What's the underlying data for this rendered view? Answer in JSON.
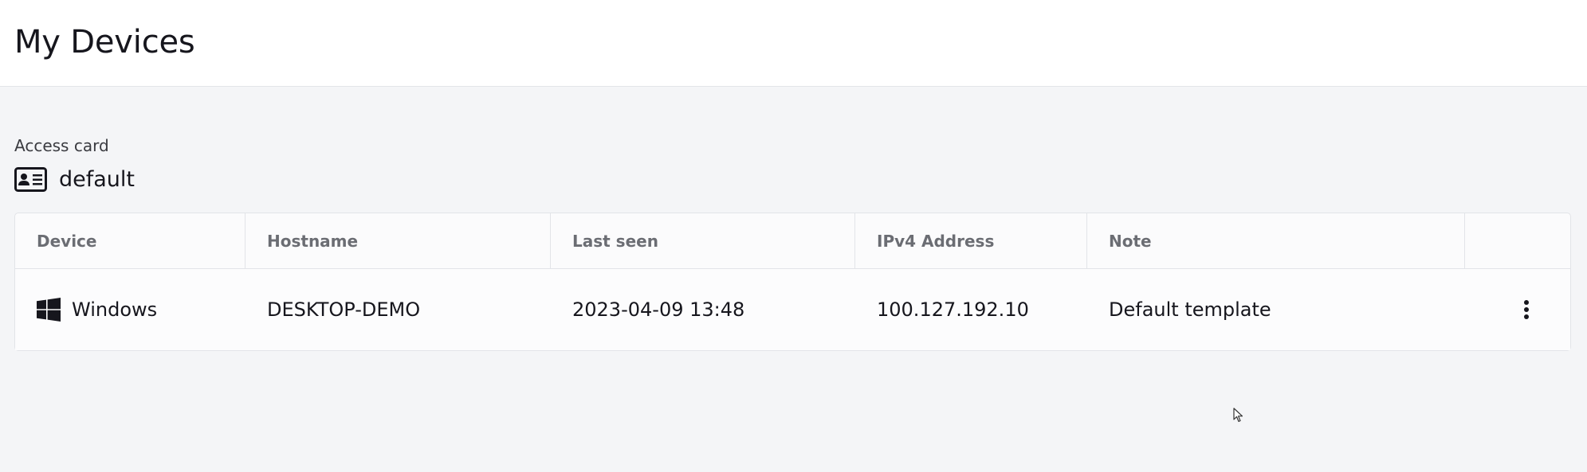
{
  "header": {
    "title": "My Devices"
  },
  "access_card": {
    "label": "Access card",
    "name": "default",
    "icon": "id-card-icon"
  },
  "table": {
    "columns": [
      "Device",
      "Hostname",
      "Last seen",
      "IPv4 Address",
      "Note",
      ""
    ],
    "rows": [
      {
        "device": "Windows",
        "device_icon": "windows-icon",
        "hostname": "DESKTOP-DEMO",
        "last_seen": "2023-04-09 13:48",
        "ipv4": "100.127.192.10",
        "note": "Default template",
        "actions_icon": "more-vertical-icon"
      }
    ]
  },
  "colors": {
    "header_bg": "#ffffff",
    "page_bg": "#f4f5f7",
    "border": "#e2e4e8",
    "header_text": "#6b6d73",
    "text": "#16161d"
  }
}
